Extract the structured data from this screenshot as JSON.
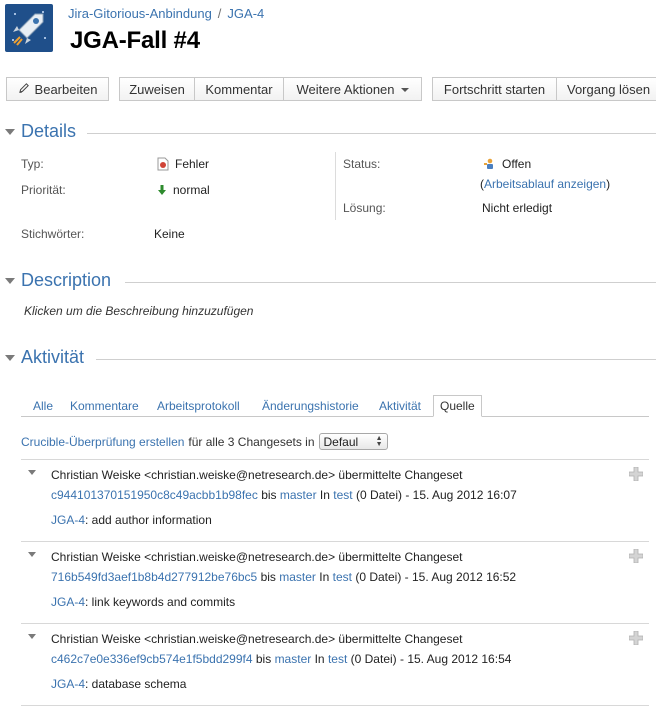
{
  "breadcrumb": {
    "project": "Jira-Gitorious-Anbindung",
    "issue_key": "JGA-4"
  },
  "issue": {
    "title": "JGA-Fall #4"
  },
  "toolbar": {
    "edit": "Bearbeiten",
    "assign": "Zuweisen",
    "comment": "Kommentar",
    "more_actions": "Weitere Aktionen",
    "start_progress": "Fortschritt starten",
    "resolve": "Vorgang lösen"
  },
  "details": {
    "heading": "Details",
    "type_label": "Typ:",
    "type_value": "Fehler",
    "priority_label": "Priorität:",
    "priority_value": "normal",
    "keywords_label": "Stichwörter:",
    "keywords_value": "Keine",
    "status_label": "Status:",
    "status_value": "Offen",
    "workflow_open": "(",
    "workflow_link": "Arbeitsablauf anzeigen",
    "workflow_close": ")",
    "resolution_label": "Lösung:",
    "resolution_value": "Nicht erledigt"
  },
  "description": {
    "heading": "Description",
    "placeholder": "Klicken um die Beschreibung hinzuzufügen"
  },
  "activity": {
    "heading": "Aktivität",
    "tabs": [
      "Alle",
      "Kommentare",
      "Arbeitsprotokoll",
      "Änderungshistorie",
      "Aktivität",
      "Quelle"
    ],
    "active_tab": "Quelle",
    "crucible_link": "Crucible-Überprüfung erstellen",
    "crucible_text": "für alle 3 Changesets in",
    "crucible_select": "Defaul"
  },
  "changesets": [
    {
      "author": "Christian Weiske <christian.weiske@netresearch.de> übermittelte Changeset",
      "hash": "c944101370151950c8c49acbb1b98fec",
      "bis": "bis",
      "branch": "master",
      "in": "In",
      "repo": "test",
      "meta": "(0 Datei) - 15. Aug 2012 16:07",
      "issue": "JGA-4",
      "message": ": add author information"
    },
    {
      "author": "Christian Weiske <christian.weiske@netresearch.de> übermittelte Changeset",
      "hash": "716b549fd3aef1b8b4d277912be76bc5",
      "bis": "bis",
      "branch": "master",
      "in": "In",
      "repo": "test",
      "meta": "(0 Datei) - 15. Aug 2012 16:52",
      "issue": "JGA-4",
      "message": ": link keywords and commits"
    },
    {
      "author": "Christian Weiske <christian.weiske@netresearch.de> übermittelte Changeset",
      "hash": "c462c7e0e336ef9cb574e1f5bdd299f4",
      "bis": "bis",
      "branch": "master",
      "in": "In",
      "repo": "test",
      "meta": "(0 Datei) - 15. Aug 2012 16:54",
      "issue": "JGA-4",
      "message": ": database schema"
    }
  ],
  "icons": {
    "avatar": "rocket-icon",
    "edit": "pencil-icon",
    "type": "bug-icon",
    "priority": "arrow-down-icon",
    "status": "open-status-icon",
    "section_toggle": "triangle-down-icon",
    "expand": "plus-icon"
  },
  "colors": {
    "link": "#3b73af",
    "heading": "#3b73af",
    "priority": "#2e8b2e",
    "bug": "#d04437"
  }
}
